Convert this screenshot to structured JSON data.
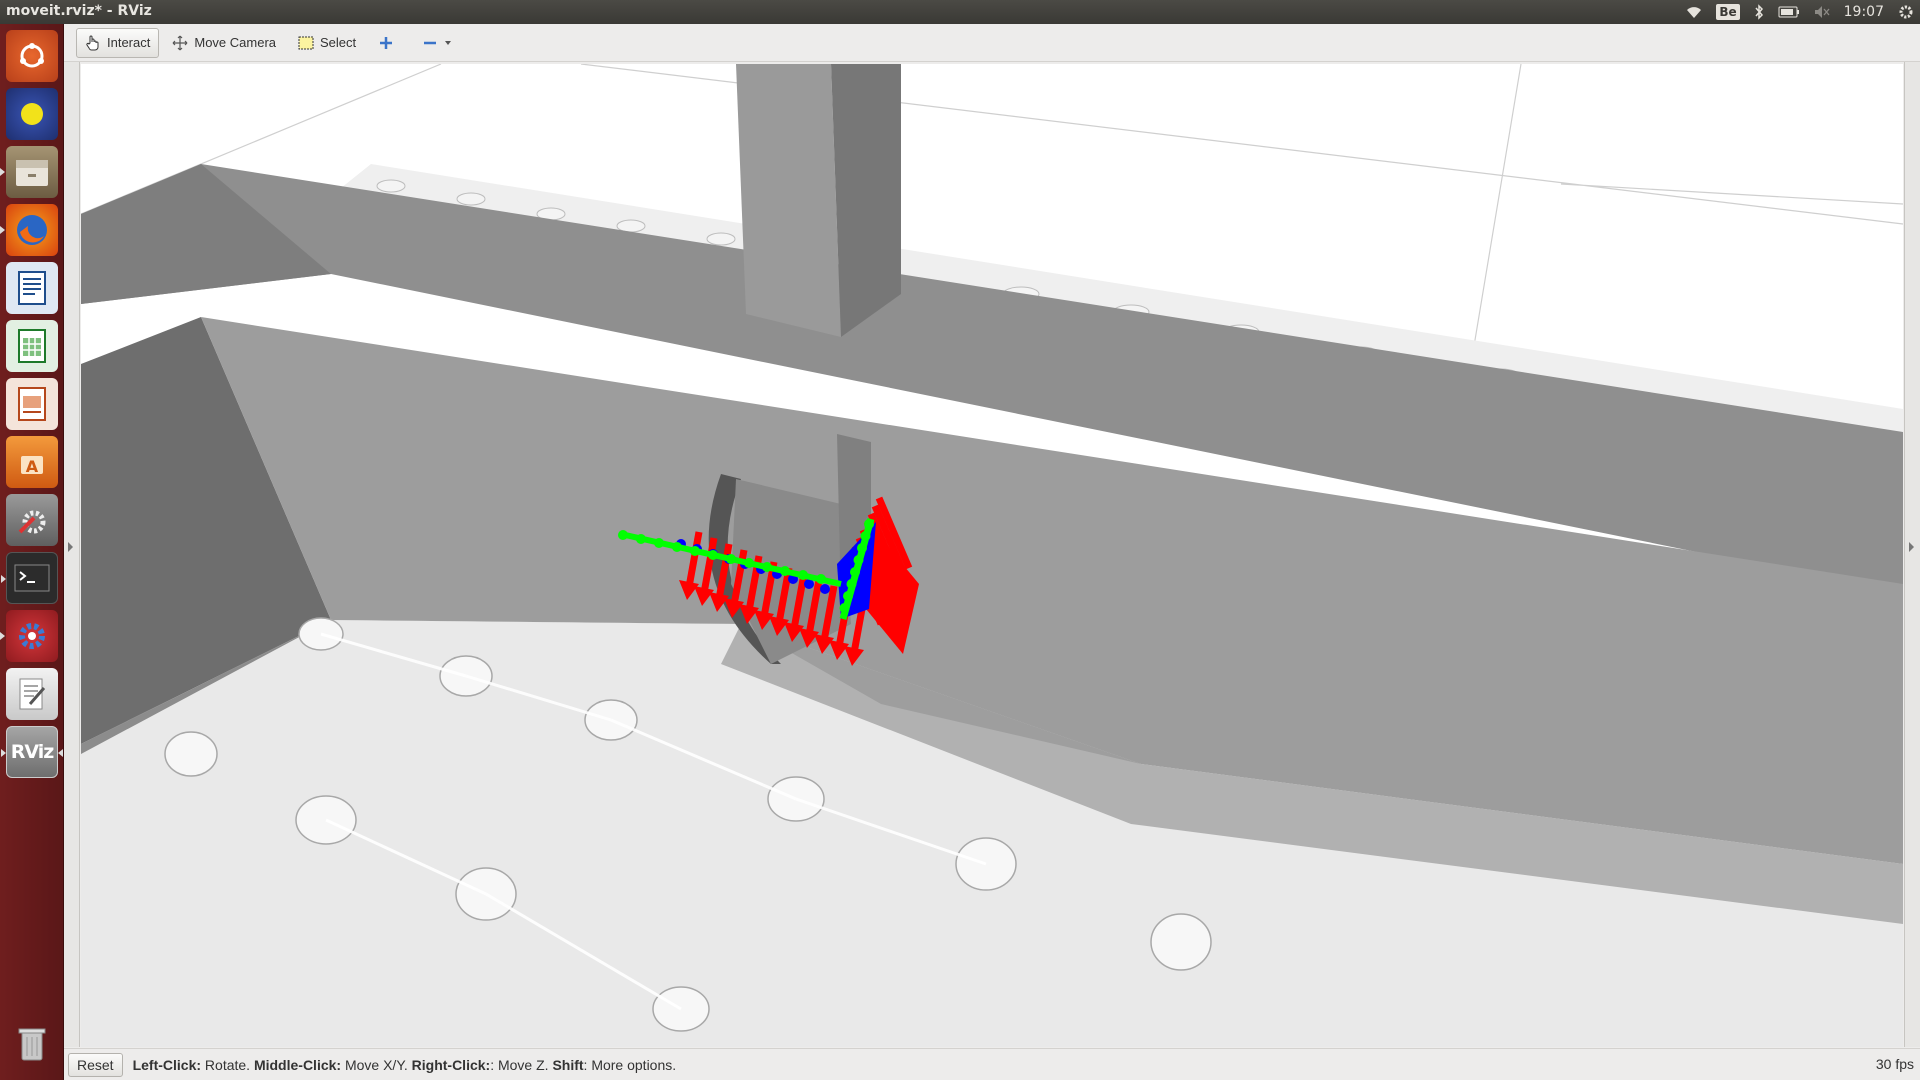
{
  "window": {
    "title": "moveit.rviz* - RViz"
  },
  "topbar": {
    "keyboard_layout": "Be",
    "clock": "19:07",
    "icons": [
      "wifi-icon",
      "keyboard-icon",
      "bluetooth-icon",
      "battery-icon",
      "volume-muted-icon",
      "settings-gear-icon"
    ]
  },
  "launcher": {
    "items": [
      {
        "name": "dash-home-icon",
        "bg": "#d9541f"
      },
      {
        "name": "system-monitor-icon",
        "bg": "#2a3f8f"
      },
      {
        "name": "files-icon",
        "bg": "#7a6a4f"
      },
      {
        "name": "firefox-icon",
        "bg": "#e66000"
      },
      {
        "name": "libreoffice-writer-icon",
        "bg": "#1f4e8c"
      },
      {
        "name": "libreoffice-calc-icon",
        "bg": "#1d7a2a"
      },
      {
        "name": "libreoffice-impress-icon",
        "bg": "#b5471c"
      },
      {
        "name": "software-center-icon",
        "bg": "#e07a22"
      },
      {
        "name": "system-settings-icon",
        "bg": "#6e6e6e"
      },
      {
        "name": "terminal-icon",
        "bg": "#2b2b2b"
      },
      {
        "name": "moveit-setup-icon",
        "bg": "#b3262a"
      },
      {
        "name": "text-editor-icon",
        "bg": "#d8d8d8"
      },
      {
        "name": "rviz-icon",
        "bg": "#8a8a8a"
      },
      {
        "name": "trash-icon",
        "bg": "#6a6a6a"
      }
    ],
    "rviz_label": "RViz"
  },
  "toolbar": {
    "interact_label": "Interact",
    "move_camera_label": "Move Camera",
    "select_label": "Select"
  },
  "statusbar": {
    "reset_label": "Reset",
    "left_click_key": "Left-Click:",
    "left_click_text": " Rotate. ",
    "middle_click_key": "Middle-Click:",
    "middle_click_text": " Move X/Y. ",
    "right_click_key": "Right-Click:",
    "right_click_text": ": Move Z. ",
    "shift_key": "Shift",
    "shift_text": ": More options.",
    "fps": "30 fps"
  },
  "colors": {
    "axis_red": "#ff0000",
    "axis_green": "#00ff00",
    "axis_blue": "#0000ff",
    "launcher_bg": "#6f1e1e",
    "topbar_bg": "#3c3b37"
  }
}
